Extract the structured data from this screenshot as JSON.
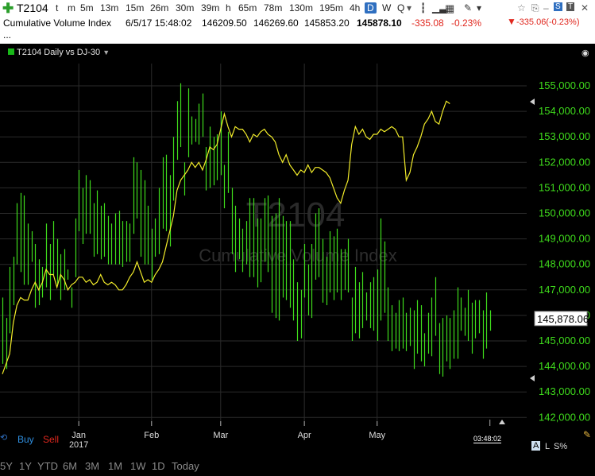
{
  "toolbar": {
    "symbol": "T2104",
    "timeframes": [
      "t",
      "m",
      "5m",
      "13m",
      "15m",
      "26m",
      "30m",
      "39m",
      "h",
      "65m",
      "78m",
      "130m",
      "195m",
      "4h",
      "D",
      "W",
      "Q"
    ],
    "selected_timeframe": "D"
  },
  "info": {
    "indicator_name": "Cumulative Volume Index",
    "datetime": "6/5/17 15:48:02",
    "open": "146209.50",
    "high": "146269.60",
    "low": "145853.20",
    "last": "145878.10",
    "change": "-335.08",
    "change_pct": "-0.23%",
    "right_change": "-335.06(-0.23%)",
    "ellipsis": "..."
  },
  "legend": {
    "text": "T2104 Daily vs DJ-30"
  },
  "watermark": {
    "symbol": "T2104",
    "name": "Cumulative Volume Index"
  },
  "buttons": {
    "buy": "Buy",
    "sell": "Sell"
  },
  "time_label": "03:48:02",
  "bottom_right": {
    "a": "A",
    "l": "L",
    "s": "S%"
  },
  "ranges": [
    "5Y",
    "1Y",
    "YTD",
    "6M",
    "3M",
    "1M",
    "1W",
    "1D",
    "Today"
  ],
  "colors": {
    "bars": "#3fdc1c",
    "comparison_line": "#f2ec2a",
    "price_box": "#ffffff",
    "negative": "#e0271e"
  },
  "chart_data": {
    "type": "line",
    "title": "T2104 Daily vs DJ-30",
    "xlabel": "",
    "ylabel": "",
    "ylim": [
      141600,
      155600
    ],
    "yticks": [
      "155,000.00",
      "154,000.00",
      "153,000.00",
      "152,000.00",
      "151,000.00",
      "150,000.00",
      "149,000.00",
      "148,000.00",
      "147,000.00",
      "146,000.00",
      "145,000.00",
      "144,000.00",
      "143,000.00",
      "142,000.00"
    ],
    "last_value_label": "145,878.06",
    "x_labels": [
      {
        "label": "Jan",
        "year": "2017",
        "index": 21
      },
      {
        "label": "Feb",
        "year": "",
        "index": 41
      },
      {
        "label": "Mar",
        "year": "",
        "index": 60
      },
      {
        "label": "Apr",
        "year": "",
        "index": 83
      },
      {
        "label": "May",
        "year": "",
        "index": 103
      }
    ],
    "series": [
      {
        "name": "T2104",
        "kind": "ohlc-bars",
        "high": [
          146700,
          145900,
          147900,
          148300,
          150400,
          150800,
          150700,
          149600,
          149300,
          148800,
          148200,
          147900,
          149600,
          148800,
          149700,
          149000,
          148400,
          148600,
          147800,
          147100,
          149800,
          151700,
          151000,
          151500,
          151300,
          150400,
          150900,
          150300,
          150400,
          149900,
          149600,
          150000,
          150100,
          149700,
          149700,
          149600,
          152200,
          152000,
          151700,
          151300,
          150300,
          149400,
          149800,
          151000,
          152200,
          152300,
          151500,
          153000,
          154400,
          155100,
          152000,
          154900,
          153800,
          153700,
          154300,
          154700,
          152600,
          153400,
          153000,
          153100,
          154000,
          151900,
          153200,
          151000,
          150300,
          149800,
          149400,
          149700,
          150600,
          150600,
          149800,
          149800,
          150600,
          150700,
          149900,
          150000,
          150600,
          149900,
          149700,
          149700,
          148200,
          147300,
          147000,
          148800,
          148000,
          148800,
          150000,
          150200,
          149000,
          148300,
          149300,
          149100,
          149400,
          148600,
          148600,
          149000,
          146700,
          147900,
          147300,
          147700,
          146900,
          147300,
          147500,
          147800,
          149800,
          148900,
          147100,
          146400,
          146100,
          146600,
          146700,
          146100,
          146300,
          146200,
          146600,
          146400,
          145300,
          146100,
          146700,
          147500,
          145700,
          145900,
          146000,
          145900,
          146200,
          147100,
          146700,
          146300,
          147000,
          146500,
          146600,
          146600,
          146200,
          146900,
          146200
        ],
        "low": [
          144100,
          143900,
          145300,
          146400,
          148000,
          147700,
          147200,
          147200,
          148100,
          146300,
          146400,
          146700,
          147100,
          146600,
          147600,
          147200,
          146600,
          147000,
          147400,
          146300,
          147500,
          149300,
          148800,
          149200,
          149200,
          148300,
          148400,
          148200,
          148300,
          148000,
          148000,
          148000,
          148000,
          147900,
          148100,
          148100,
          149200,
          149800,
          148300,
          148000,
          148000,
          147400,
          148300,
          148400,
          149400,
          149300,
          148700,
          150500,
          152100,
          152600,
          150700,
          152200,
          152700,
          152800,
          152700,
          153000,
          150900,
          151000,
          151100,
          151300,
          151500,
          150200,
          150800,
          148400,
          147700,
          148200,
          147700,
          148000,
          147500,
          147500,
          147100,
          147300,
          148100,
          147700,
          146100,
          145900,
          145800,
          146700,
          146600,
          146300,
          145800,
          145000,
          145100,
          146700,
          146000,
          145900,
          147400,
          147500,
          146500,
          146400,
          146900,
          146600,
          146900,
          146600,
          147000,
          146900,
          145000,
          145300,
          145100,
          145500,
          145800,
          145500,
          145400,
          145000,
          145800,
          146100,
          145000,
          144600,
          144700,
          144600,
          144700,
          144600,
          144800,
          143900,
          144500,
          144200,
          144000,
          144500,
          144400,
          145200,
          143700,
          143600,
          144200,
          143900,
          144300,
          144300,
          145400,
          145200,
          145000,
          144500,
          145100,
          145300,
          144300,
          144700,
          145400
        ]
      },
      {
        "name": "DJ-30",
        "kind": "line",
        "values": [
          143700,
          144100,
          144500,
          145700,
          146400,
          146700,
          146600,
          146600,
          147000,
          147300,
          147000,
          147300,
          147800,
          147600,
          147600,
          147100,
          147600,
          147400,
          147000,
          147200,
          147300,
          147500,
          147500,
          147300,
          147400,
          147200,
          147300,
          147600,
          147300,
          147200,
          147300,
          147200,
          147000,
          147000,
          147200,
          147500,
          147700,
          148100,
          147700,
          147300,
          147400,
          147300,
          147600,
          147800,
          148100,
          148700,
          149300,
          149900,
          150900,
          151300,
          151500,
          151700,
          152000,
          151800,
          152000,
          151700,
          152100,
          152600,
          152500,
          152700,
          153300,
          153900,
          153400,
          153000,
          153400,
          153300,
          153300,
          153100,
          152800,
          153100,
          153000,
          153200,
          153300,
          153100,
          153000,
          152800,
          152300,
          152000,
          152300,
          151900,
          151700,
          151500,
          151700,
          151600,
          151900,
          151600,
          151800,
          151800,
          151700,
          151600,
          151400,
          151000,
          150600,
          150400,
          150900,
          151300,
          152700,
          153400,
          153100,
          153300,
          153000,
          152900,
          153100,
          153100,
          153300,
          153200,
          153300,
          153400,
          153300,
          153000,
          153000,
          151300,
          151600,
          152300,
          152600,
          153000,
          153500,
          153700,
          154000,
          153600,
          153500,
          154000,
          154400,
          154300
        ]
      }
    ]
  }
}
